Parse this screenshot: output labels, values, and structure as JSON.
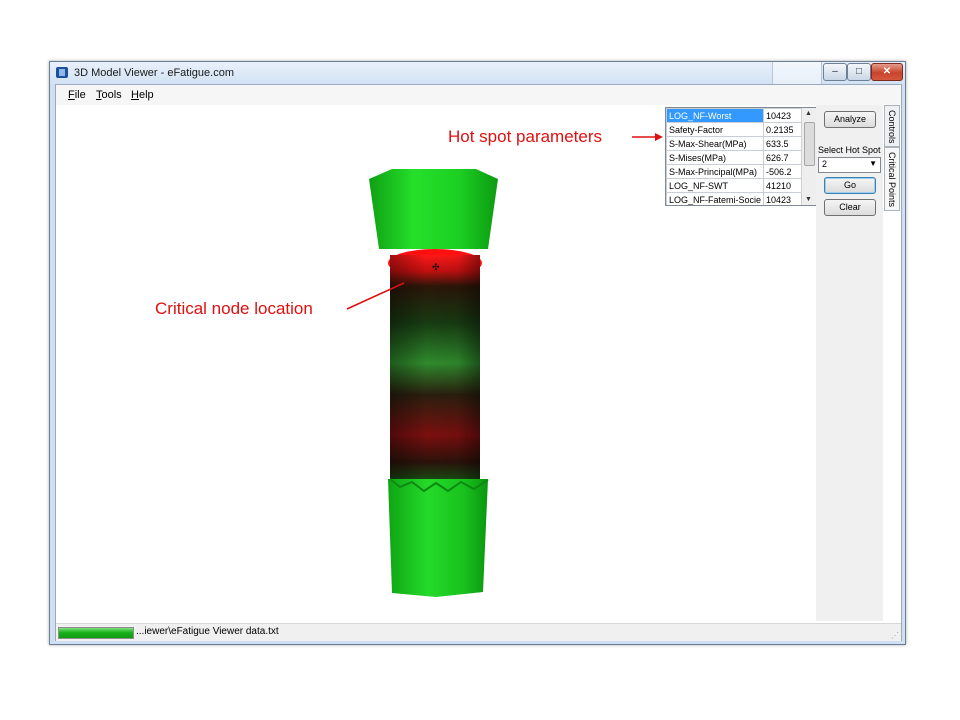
{
  "window": {
    "title": "3D Model Viewer - eFatigue.com"
  },
  "caption_buttons": {
    "minimize": "–",
    "maximize": "□",
    "close": "✕"
  },
  "menu": [
    "File",
    "Tools",
    "Help"
  ],
  "annotations": {
    "hot_spot": "Hot spot parameters",
    "critical_node": "Critical node location",
    "color": "#e01010"
  },
  "grid_rows": [
    {
      "name": "LOG_NF-Worst",
      "value": "10423"
    },
    {
      "name": "Safety-Factor",
      "value": "0.2135"
    },
    {
      "name": "S-Max-Shear(MPa)",
      "value": "633.5"
    },
    {
      "name": "S-Mises(MPa)",
      "value": "626.7"
    },
    {
      "name": "S-Max-Principal(MPa)",
      "value": "-506.2"
    },
    {
      "name": "LOG_NF-SWT",
      "value": "41210"
    },
    {
      "name": "LOG_NF-Fatemi-Socie",
      "value": "10423"
    }
  ],
  "panel": {
    "analyze_button": "Analyze",
    "select_label": "Select Hot Spot",
    "select_value": "2",
    "go_button": "Go",
    "clear_button": "Clear"
  },
  "tabs": {
    "controls": "Controls",
    "critical_points": "Critical Points"
  },
  "status": {
    "path": "...iewer\\eFatigue Viewer data.txt",
    "progress": 1.0
  },
  "colors": {
    "model_green": "#15c81a",
    "model_red": "#ff1010",
    "selection": "#3399ff"
  }
}
